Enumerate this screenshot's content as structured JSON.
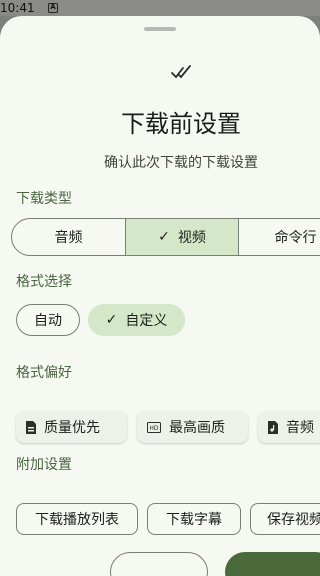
{
  "status_bar": {
    "time": "10:41",
    "notification_icon": "download-notification-icon"
  },
  "sheet": {
    "header_icon": "download-done-icon",
    "title": "下载前设置",
    "subtitle": "确认此次下载的下载设置"
  },
  "download_type": {
    "label": "下载类型",
    "options": [
      "音频",
      "视频",
      "命令行"
    ],
    "selected": "视频"
  },
  "format_select": {
    "label": "格式选择",
    "options": [
      "自动",
      "自定义"
    ],
    "selected": "自定义"
  },
  "format_preference": {
    "label": "格式偏好",
    "options": [
      {
        "label": "质量优先",
        "icon": "file-icon"
      },
      {
        "label": "最高画质",
        "icon": "hd-icon"
      },
      {
        "label": "音频",
        "icon": "audio-file-icon"
      }
    ]
  },
  "additional_settings": {
    "label": "附加设置",
    "options": [
      "下载播放列表",
      "下载字幕",
      "保存视频"
    ]
  },
  "colors": {
    "accent": "#4a6a3c",
    "selected_bg": "#d5e7c9",
    "section_label": "#4b6541"
  }
}
